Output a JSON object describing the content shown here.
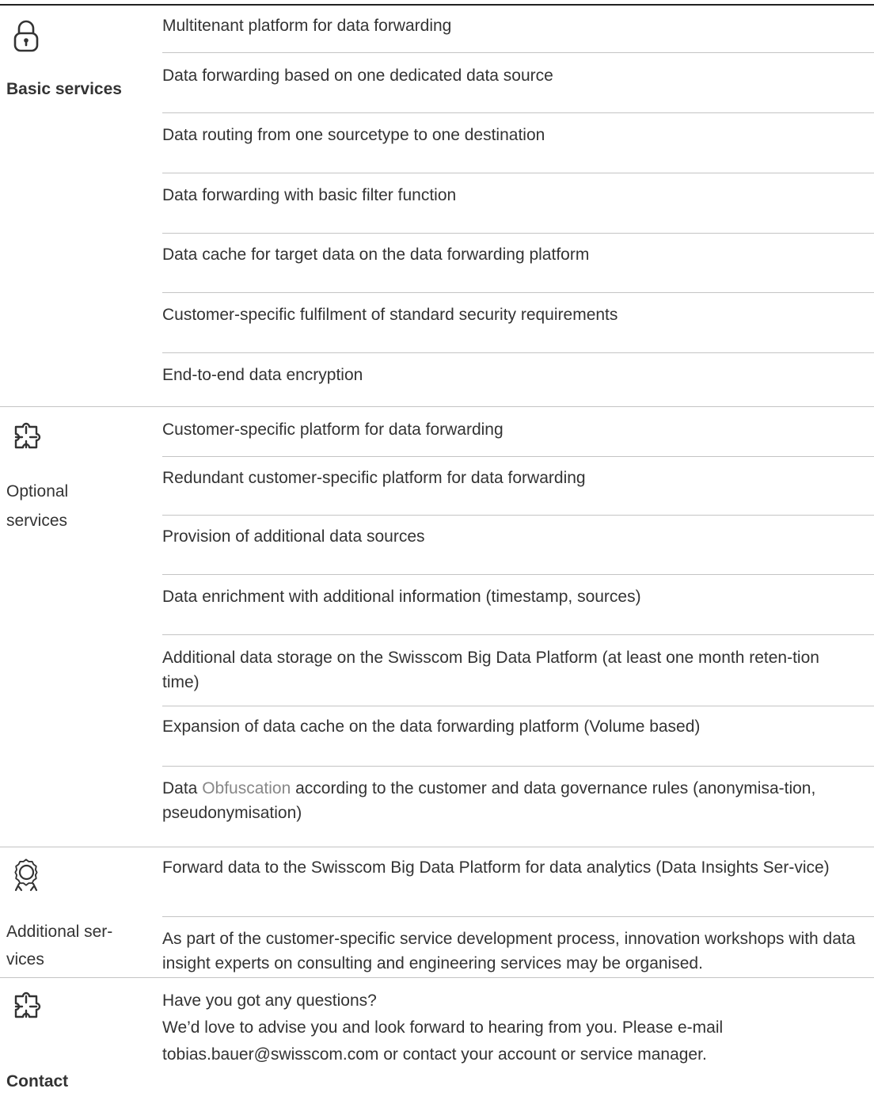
{
  "sections": {
    "basic": {
      "label": "Basic services",
      "icon": "lock-icon",
      "items": [
        "Multitenant platform for data forwarding",
        "Data forwarding based on one dedicated data source",
        "Data routing from one sourcetype to one destination",
        "Data forwarding with basic filter function",
        "Data cache for target data on the data forwarding platform",
        "Customer-specific fulfilment of standard security requirements",
        "End-to-end data encryption"
      ]
    },
    "optional": {
      "label_line1": "Optional",
      "label_line2": "services",
      "icon": "puzzle-icon",
      "items": [
        "Customer-specific platform for data forwarding",
        "Redundant customer-specific platform for data forwarding",
        "Provision of additional data sources",
        "Data enrichment with additional information (timestamp, sources)",
        "Additional data storage on the Swisscom Big Data Platform (at least one month reten-tion time)",
        "Expansion of data cache on the data forwarding platform (Volume based)"
      ],
      "obfuscation": {
        "prefix": "Data ",
        "highlight": "Obfuscation",
        "suffix": " according to the customer and data governance rules (anonymisa-tion, pseudonymisation)"
      }
    },
    "additional": {
      "label_line1": "Additional ser-",
      "label_line2": "vices",
      "icon": "award-badge-icon",
      "items": [
        "Forward data to the Swisscom Big Data Platform for data analytics (Data Insights Ser-vice)",
        "As part of the customer-specific service development process, innovation workshops with data insight experts on consulting and engineering services may be organised."
      ]
    },
    "contact": {
      "label": "Contact",
      "icon": "puzzle-icon",
      "line1": "Have you got any questions?",
      "line2": "We’d love to advise you and look forward to hearing from you. Please e-mail",
      "line3": "tobias.bauer@swisscom.com or contact your account or service manager."
    }
  }
}
